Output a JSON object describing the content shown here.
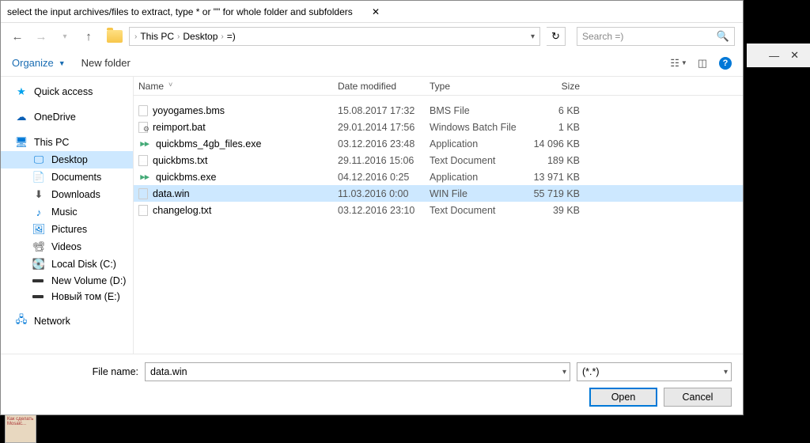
{
  "title": "select the input archives/files to extract, type * or \"\" for whole folder and subfolders",
  "nav": {
    "breadcrumb": {
      "p1": "This PC",
      "p2": "Desktop",
      "p3": "=)"
    },
    "search_placeholder": "Search =)"
  },
  "toolbar": {
    "organize": "Organize",
    "newfolder": "New folder"
  },
  "sidebar": {
    "quick": "Quick access",
    "onedrive": "OneDrive",
    "thispc": "This PC",
    "desktop": "Desktop",
    "documents": "Documents",
    "downloads": "Downloads",
    "music": "Music",
    "pictures": "Pictures",
    "videos": "Videos",
    "localdisk": "Local Disk (C:)",
    "newvol": "New Volume (D:)",
    "novyi": "Новый том (E:)",
    "network": "Network"
  },
  "columns": {
    "name": "Name",
    "date": "Date modified",
    "type": "Type",
    "size": "Size"
  },
  "files": [
    {
      "name": "yoyogames.bms",
      "date": "15.08.2017 17:32",
      "type": "BMS File",
      "size": "6 KB",
      "ico": "blank",
      "selected": false
    },
    {
      "name": "reimport.bat",
      "date": "29.01.2014 17:56",
      "type": "Windows Batch File",
      "size": "1 KB",
      "ico": "bat",
      "selected": false
    },
    {
      "name": "quickbms_4gb_files.exe",
      "date": "03.12.2016 23:48",
      "type": "Application",
      "size": "14 096 KB",
      "ico": "exe",
      "selected": false
    },
    {
      "name": "quickbms.txt",
      "date": "29.11.2016 15:06",
      "type": "Text Document",
      "size": "189 KB",
      "ico": "txt",
      "selected": false
    },
    {
      "name": "quickbms.exe",
      "date": "04.12.2016 0:25",
      "type": "Application",
      "size": "13 971 KB",
      "ico": "exe",
      "selected": false
    },
    {
      "name": "data.win",
      "date": "11.03.2016 0:00",
      "type": "WIN File",
      "size": "55 719 KB",
      "ico": "blank",
      "selected": true
    },
    {
      "name": "changelog.txt",
      "date": "03.12.2016 23:10",
      "type": "Text Document",
      "size": "39 KB",
      "ico": "txt",
      "selected": false
    }
  ],
  "footer": {
    "filename_label": "File name:",
    "filename_value": "data.win",
    "filter": "(*.*)",
    "open": "Open",
    "cancel": "Cancel"
  },
  "taskbar_thumb": "Как сделать Mosaic...",
  "outer_min": "—",
  "outer_close": "✕"
}
